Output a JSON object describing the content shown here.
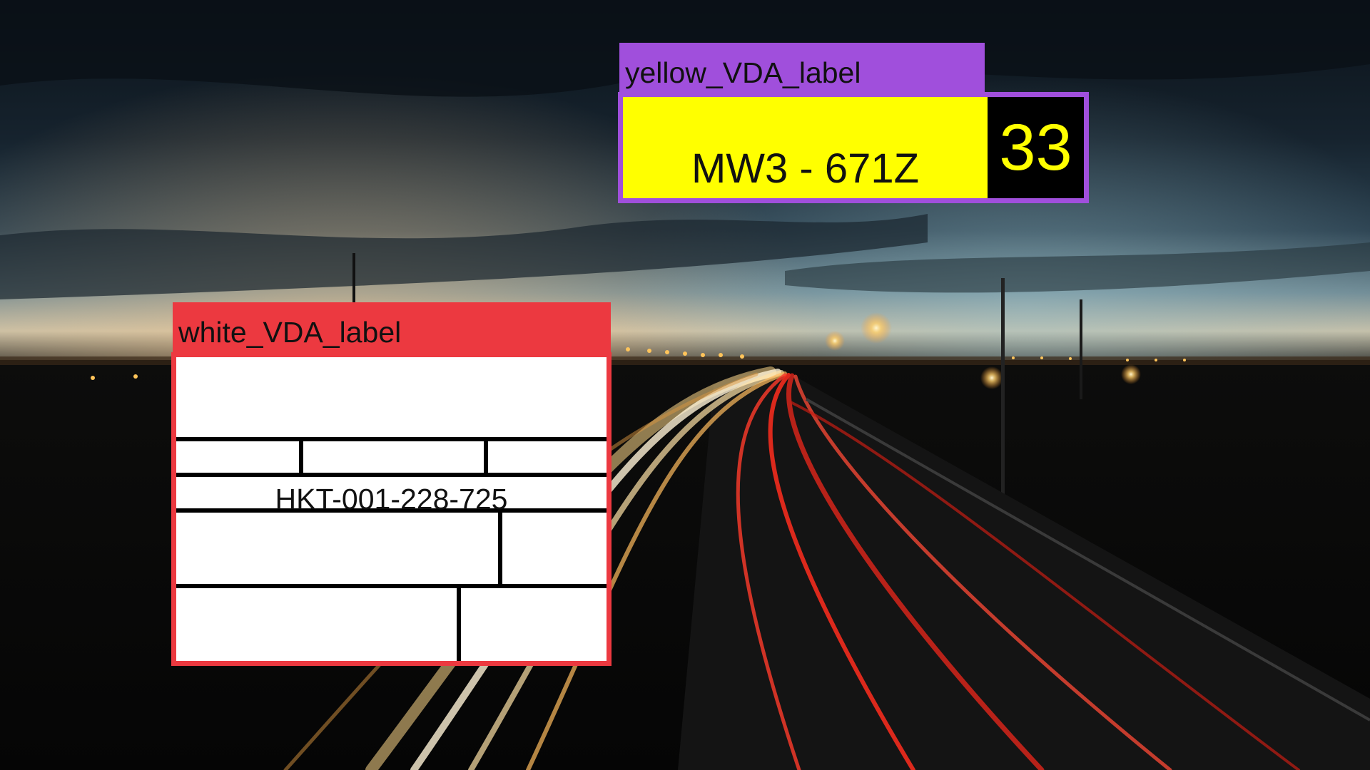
{
  "annotations": {
    "white_vda": {
      "tag": "white_VDA_label",
      "color": "#ec3940",
      "code": "HKT-001-228-725"
    },
    "yellow_vda": {
      "tag": "yellow_VDA_label",
      "color": "#a04fdc",
      "code": "MW3 - 671Z",
      "number": "33",
      "label_color": "#ffff00",
      "number_color": "#ffff00"
    }
  }
}
